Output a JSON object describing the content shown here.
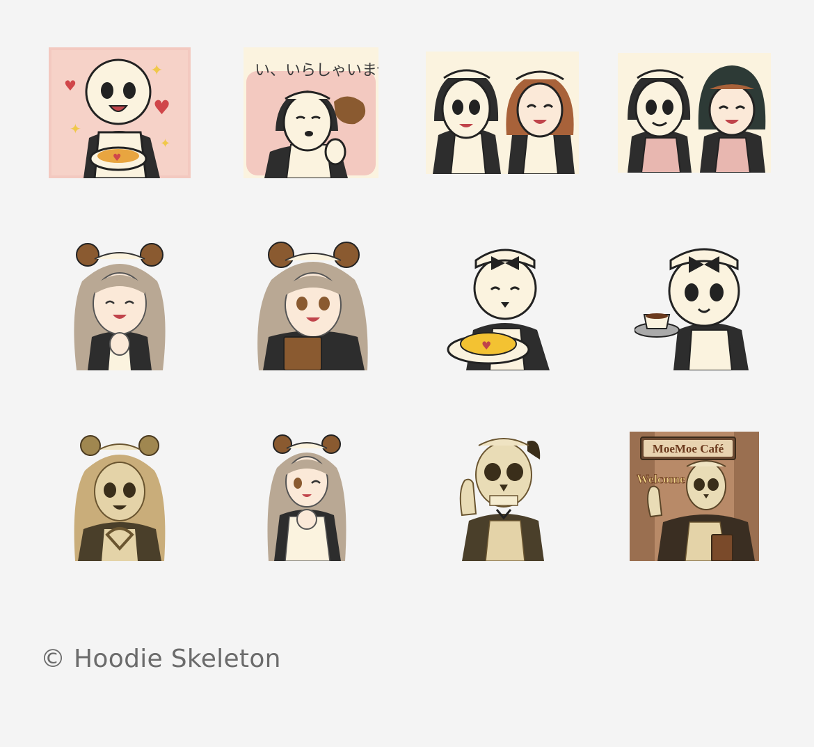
{
  "stickers": [
    {
      "id": 1,
      "name": "skeleton-maid-latte"
    },
    {
      "id": 2,
      "name": "skeleton-maid-irasshaimase",
      "caption": "い、いらしゃいませ"
    },
    {
      "id": 3,
      "name": "skeleton-and-girl-maids-clapping"
    },
    {
      "id": 4,
      "name": "skeleton-and-girl-maids-smiling"
    },
    {
      "id": 5,
      "name": "bear-ear-maid-girl-happy"
    },
    {
      "id": 6,
      "name": "bear-ear-maid-girl-menu"
    },
    {
      "id": 7,
      "name": "skeleton-maid-omurice"
    },
    {
      "id": 8,
      "name": "skeleton-maid-coffee"
    },
    {
      "id": 9,
      "name": "skull-maid-heart-hands"
    },
    {
      "id": 10,
      "name": "bear-ear-maid-girl-wink"
    },
    {
      "id": 11,
      "name": "realistic-skull-maid-wave"
    },
    {
      "id": 12,
      "name": "realistic-skull-maid-welcome",
      "sign": "MoeMoe Café",
      "welcome": "Welcome"
    }
  ],
  "footer": {
    "copyright": "© Hoodie Skeleton"
  },
  "colors": {
    "background": "#f4f4f4",
    "copyright_text": "#6b6b6b",
    "cream": "#fbf3df",
    "pink_bg": "#f3c9c0",
    "sepia": "#c9ad7a"
  }
}
